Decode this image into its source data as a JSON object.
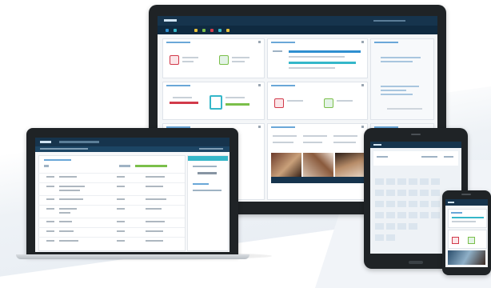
{
  "colors": {
    "background": "#ffffff",
    "bezel": "#1f2326",
    "app_header": "#16344d",
    "app_nav": "#0f2a40",
    "accent_blue": "#2f8fd0",
    "accent_cyan": "#35b7c9",
    "accent_green": "#7bbf4a",
    "accent_red": "#d23a4a",
    "accent_yellow": "#e8c13a"
  },
  "devices": [
    "monitor",
    "laptop",
    "tablet",
    "phone"
  ]
}
